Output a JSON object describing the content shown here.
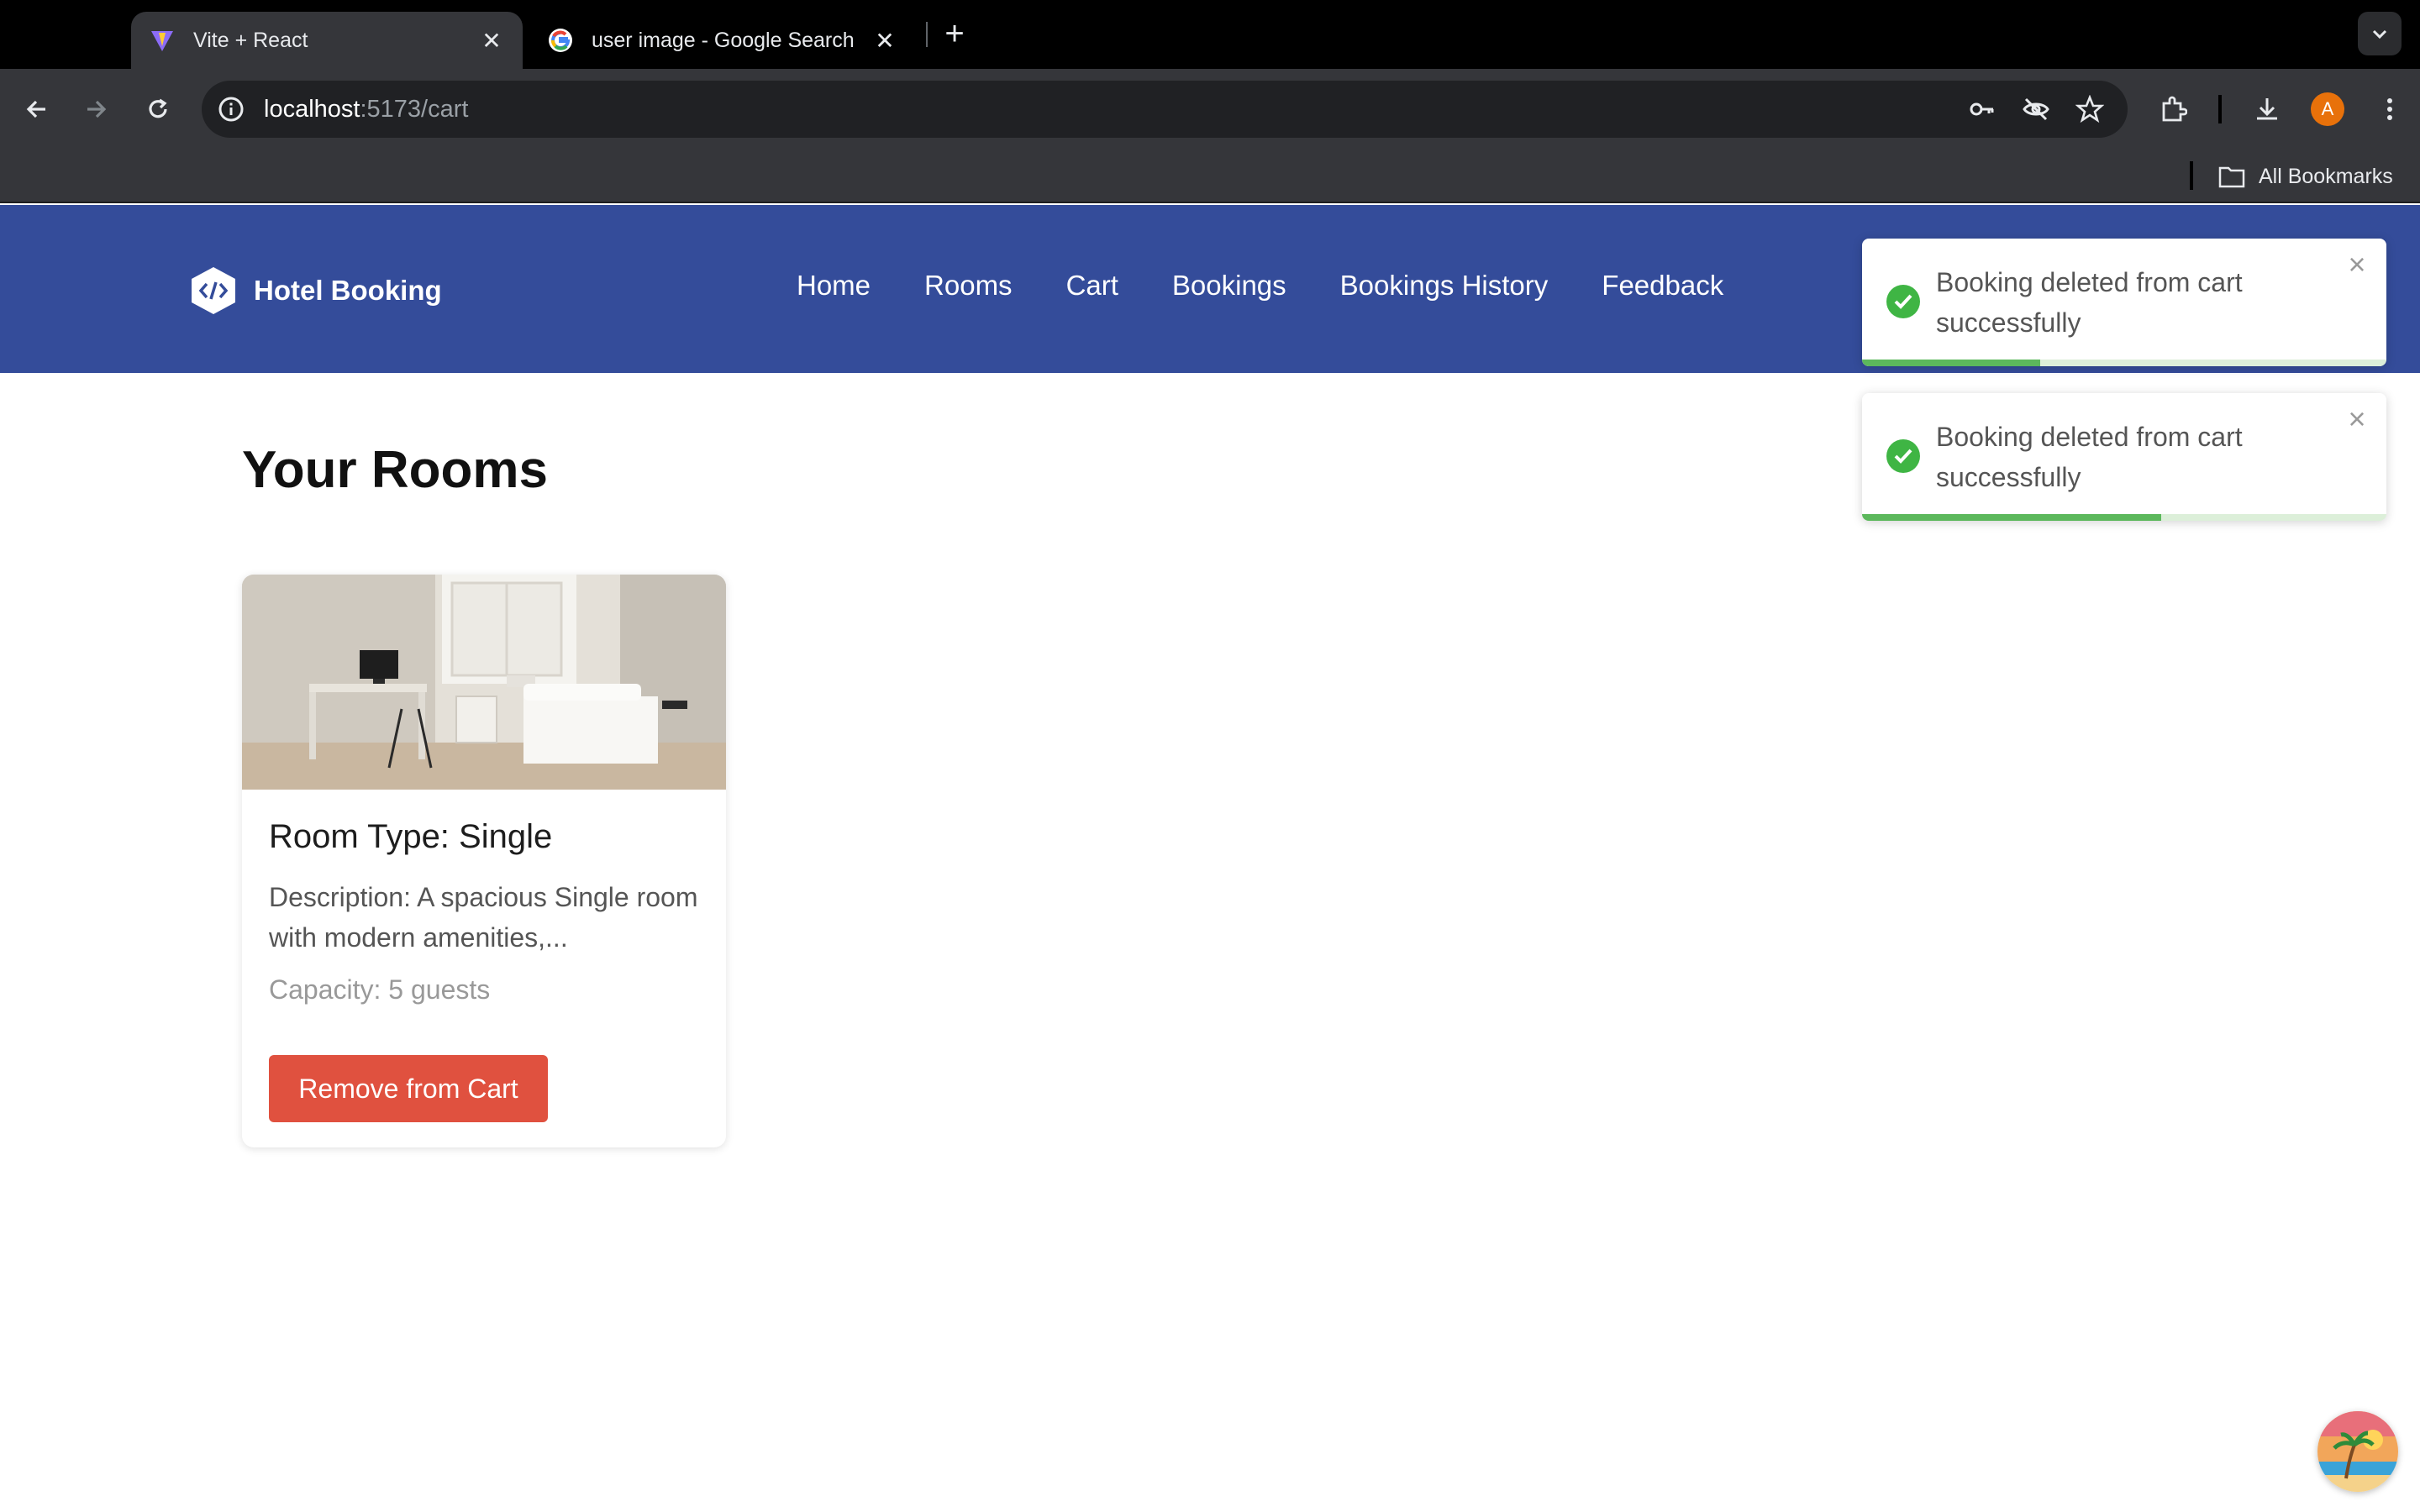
{
  "browser": {
    "tabs": [
      {
        "title": "Vite + React",
        "icon": "vite-icon",
        "active": true
      },
      {
        "title": "user image - Google Search",
        "icon": "google-icon",
        "active": false
      }
    ],
    "url_host": "localhost",
    "url_rest": ":5173/cart",
    "bookmarks_label": "All Bookmarks",
    "profile_initial": "A"
  },
  "header": {
    "brand": "Hotel Booking",
    "nav": [
      "Home",
      "Rooms",
      "Cart",
      "Bookings",
      "Bookings History",
      "Feedback"
    ]
  },
  "main": {
    "title": "Your Rooms",
    "card": {
      "room_type": "Room Type: Single",
      "description": "Description: A spacious Single room with modern amenities,...",
      "capacity": "Capacity: 5 guests",
      "button": "Remove from Cart"
    }
  },
  "toasts": [
    {
      "message": "Booking deleted from cart successfully",
      "progress": 0.34
    },
    {
      "message": "Booking deleted from cart successfully",
      "progress": 0.57
    }
  ],
  "colors": {
    "header_bg": "#344c9a",
    "danger": "#e0513f",
    "success": "#5cb85c"
  }
}
